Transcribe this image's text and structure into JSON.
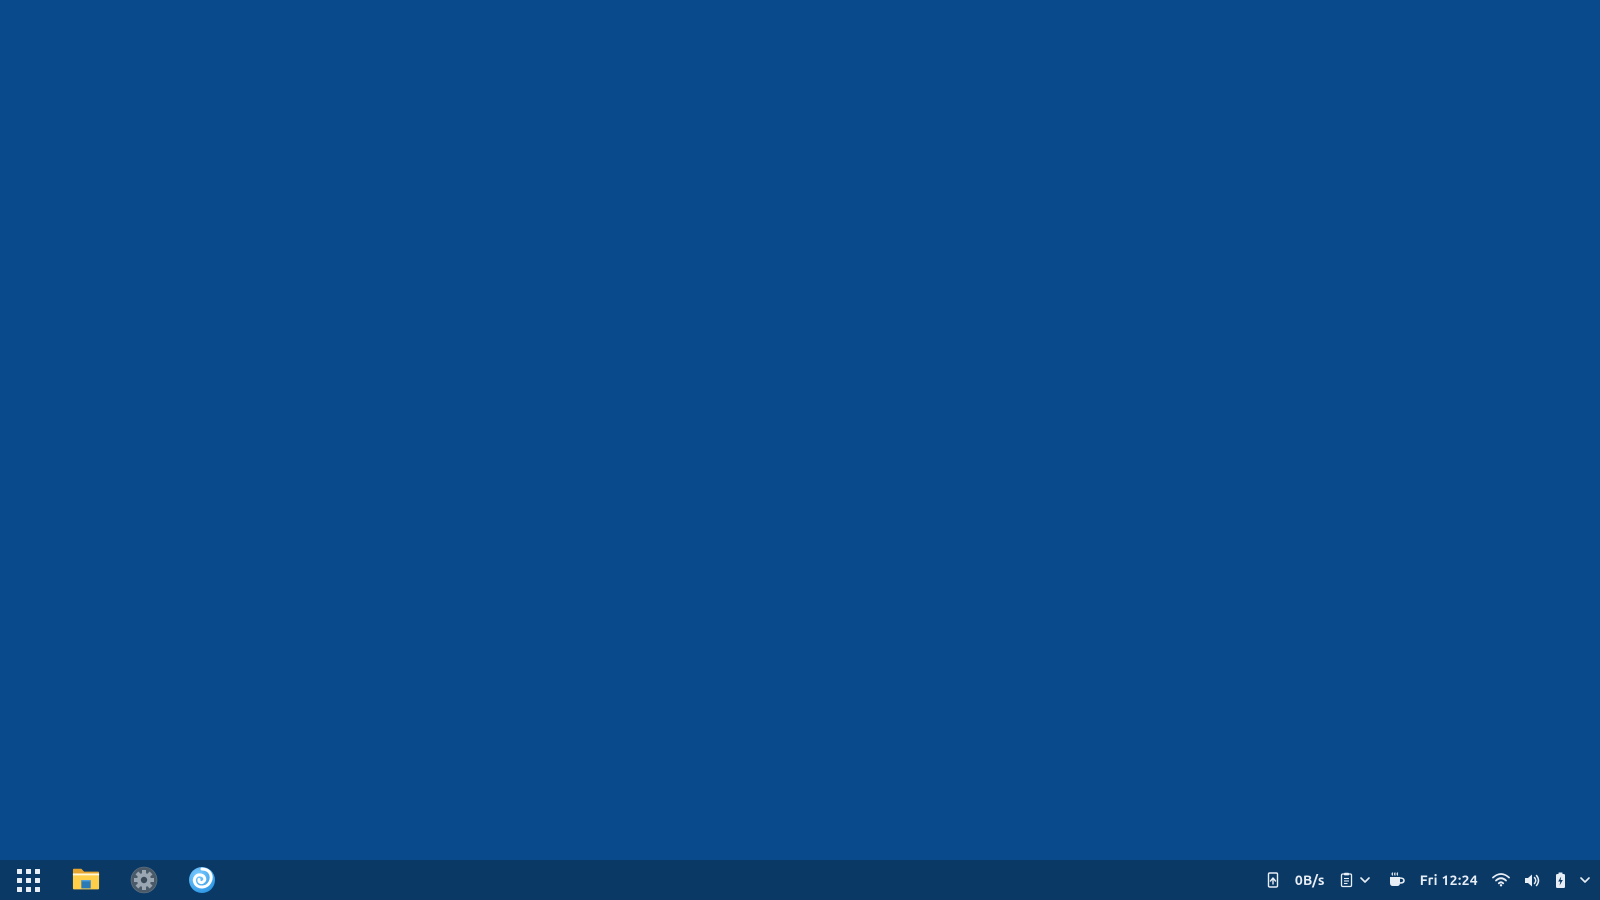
{
  "desktop": {
    "background_color": "#084a8c"
  },
  "taskbar": {
    "background_color": "#0a3966",
    "left_items": [
      {
        "id": "apps",
        "label": "Applications"
      },
      {
        "id": "files",
        "label": "File Manager"
      },
      {
        "id": "settings",
        "label": "Settings"
      },
      {
        "id": "browser",
        "label": "Web Browser"
      }
    ],
    "tray": {
      "device_icon": "phone-sync",
      "net_speed": "0B/s",
      "clipboard_icon": "clipboard",
      "caffeine_icon": "coffee-cup",
      "clock": "Fri 12:24",
      "wifi_icon": "wifi",
      "volume_icon": "volume",
      "battery_icon": "battery-charging",
      "expand_icon": "chevron-down"
    }
  }
}
